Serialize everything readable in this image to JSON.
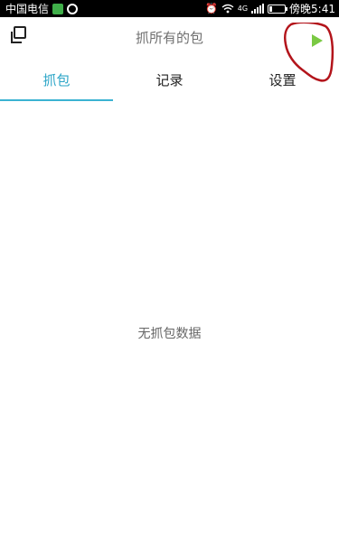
{
  "status_bar": {
    "carrier": "中国电信",
    "time": "傍晚5:41",
    "network_label": "4G",
    "battery_level": 0.2,
    "icons": [
      "app-green-icon",
      "app-ring-icon",
      "alarm-icon",
      "wifi-icon",
      "signal-icon",
      "battery-icon"
    ]
  },
  "header": {
    "title": "抓所有的包",
    "copy_icon": "copy-icon",
    "play_icon": "play-icon",
    "accent_color": "#7ac943",
    "annotation_color": "#b3141b"
  },
  "tabs": [
    {
      "label": "抓包",
      "active": true
    },
    {
      "label": "记录",
      "active": false
    },
    {
      "label": "设置",
      "active": false
    }
  ],
  "tab_active_color": "#2ba5c7",
  "empty_state": {
    "message": "无抓包数据"
  }
}
